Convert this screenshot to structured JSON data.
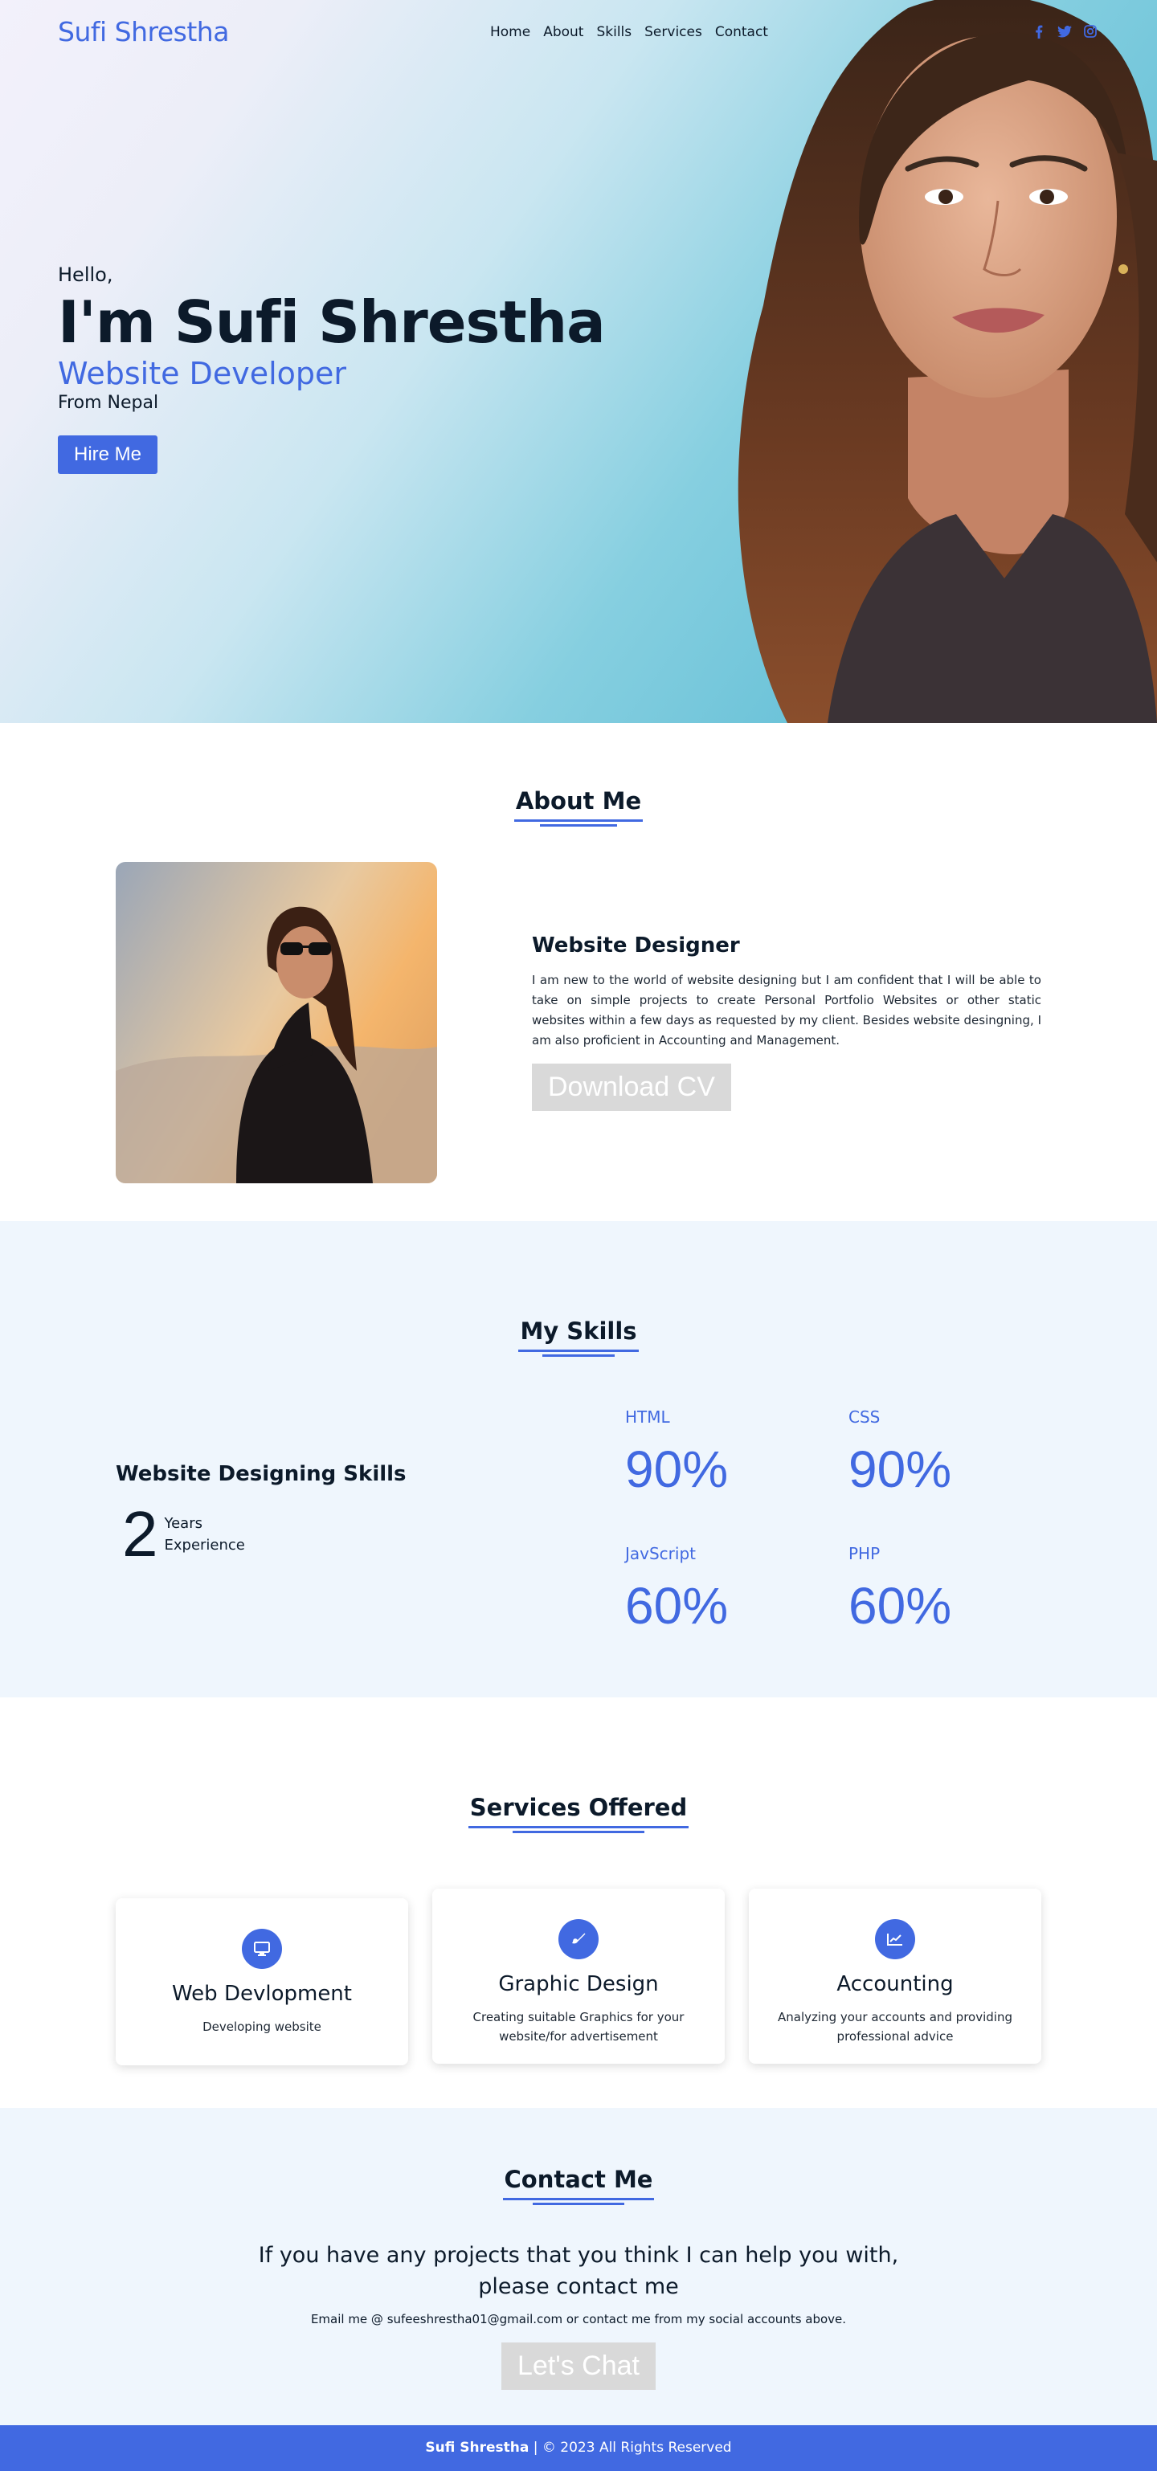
{
  "brand": {
    "name": "Sufi Shrestha",
    "accent": "#4169e1",
    "dark": "#0c1a2a",
    "light_bg": "#eff6fd"
  },
  "nav": {
    "links": [
      "Home",
      "About",
      "Skills",
      "Services",
      "Contact"
    ],
    "socials": [
      "facebook-icon",
      "twitter-icon",
      "instagram-icon"
    ]
  },
  "hero": {
    "greeting": "Hello,",
    "name": "I'm Sufi Shrestha",
    "role": "Website Developer",
    "from": "From Nepal",
    "cta": "Hire Me"
  },
  "about": {
    "title": "About Me",
    "subtitle": "Website Designer",
    "description": "I am new to the world of website designing but I am confident that I will be able to take on simple projects to create Personal Portfolio Websites or other static websites within a few days as requested by my client. Besides website desingning, I am also proficient in Accounting and Management.",
    "cta": "Download CV"
  },
  "skills": {
    "title": "My Skills",
    "subtitle": "Website Designing Skills",
    "experience_number": "2",
    "experience_line1": "Years",
    "experience_line2": "Experience",
    "items": [
      {
        "name": "HTML",
        "percent": "90%"
      },
      {
        "name": "CSS",
        "percent": "90%"
      },
      {
        "name": "JavScript",
        "percent": "60%"
      },
      {
        "name": "PHP",
        "percent": "60%"
      }
    ]
  },
  "services": {
    "title": "Services Offered",
    "items": [
      {
        "icon": "monitor-icon",
        "title": "Web Devlopment",
        "desc": "Developing website"
      },
      {
        "icon": "paintbrush-icon",
        "title": "Graphic Design",
        "desc": "Creating suitable Graphics for your website/for advertisement"
      },
      {
        "icon": "chart-line-icon",
        "title": "Accounting",
        "desc": "Analyzing your accounts and providing professional advice"
      }
    ]
  },
  "contact": {
    "title": "Contact Me",
    "lead": "If you have any projects that you think I can help you with, please contact me",
    "email_line": "Email me @ sufeeshrestha01@gmail.com or contact me from my social accounts above.",
    "cta": "Let's Chat"
  },
  "footer": {
    "name": "Sufi Shrestha",
    "rest": " | © 2023 All Rights Reserved"
  }
}
